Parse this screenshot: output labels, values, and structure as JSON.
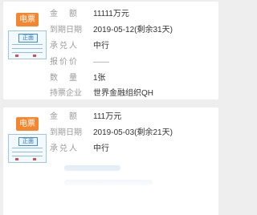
{
  "listings": [
    {
      "badge": "电票",
      "bill_icon_text": "正面",
      "amount_label": "金额",
      "amount_value": "11111万元",
      "maturity_label": "到期日期",
      "maturity_value": "2019-05-12(剩余31天)",
      "acceptor_label": "承兑人",
      "acceptor_value": "中行",
      "price_label": "报价价",
      "price_value": "——",
      "quantity_label": "数量",
      "quantity_value": "1张",
      "holder_label": "持票企业",
      "holder_value": "世界金融组织QH"
    },
    {
      "badge": "电票",
      "bill_icon_text": "正面",
      "amount_label": "金额",
      "amount_value": "111万元",
      "maturity_label": "到期日期",
      "maturity_value": "2019-05-03(剩余21天)",
      "acceptor_label": "承兑人",
      "acceptor_value": "中行"
    }
  ]
}
